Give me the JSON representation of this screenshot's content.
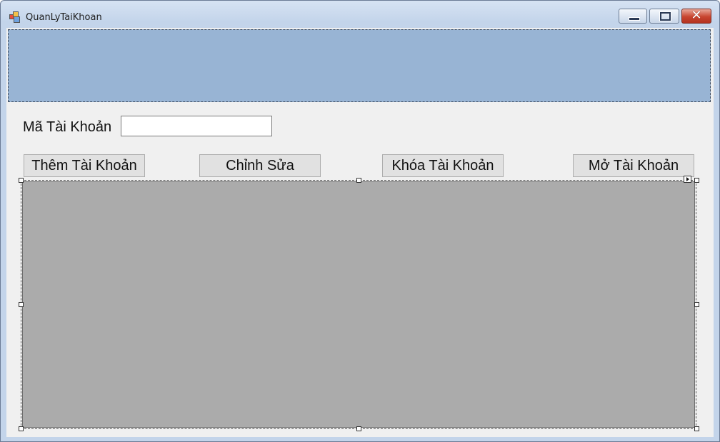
{
  "window": {
    "title": "QuanLyTaiKhoan",
    "icons": {
      "app": "form-icon",
      "minimize": "minimize-icon",
      "maximize": "maximize-icon",
      "close": "close-icon"
    },
    "close_glyph": "✕"
  },
  "form": {
    "ma_label": "Mã Tài Khoản",
    "ma_value": "",
    "buttons": {
      "them": "Thêm Tài Khoản",
      "sua": "Chỉnh Sửa",
      "khoa": "Khóa Tài Khoản",
      "mo": "Mở Tài Khoản"
    }
  },
  "colors": {
    "header_panel": "#98b4d4",
    "grid_background": "#ababab",
    "client_background": "#f0f0f0"
  }
}
